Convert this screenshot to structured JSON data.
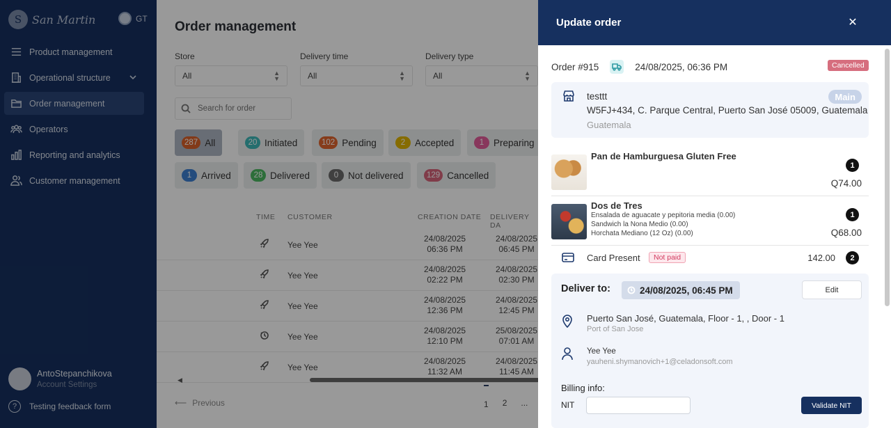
{
  "sidebar": {
    "brand": "San Martin",
    "country": "GT",
    "items": [
      {
        "label": "Product management",
        "icon": "menu-icon"
      },
      {
        "label": "Operational structure",
        "icon": "building-icon"
      },
      {
        "label": "Order management",
        "icon": "folder-icon"
      },
      {
        "label": "Operators",
        "icon": "users-icon"
      },
      {
        "label": "Reporting and analytics",
        "icon": "bar-chart-icon"
      },
      {
        "label": "Customer management",
        "icon": "user-group-icon"
      }
    ],
    "user": {
      "name": "AntoStepanchikova",
      "sub": "Account Settings"
    },
    "feedback": "Testing feedback form"
  },
  "main": {
    "title": "Order management",
    "filters": [
      {
        "label": "Store",
        "value": "All"
      },
      {
        "label": "Delivery time",
        "value": "All"
      },
      {
        "label": "Delivery type",
        "value": "All"
      }
    ],
    "search_placeholder": "Search for order",
    "chips": [
      {
        "count": "287",
        "label": "All",
        "color": "#d9622b"
      },
      {
        "count": "20",
        "label": "Initiated",
        "color": "#3fb8b8"
      },
      {
        "count": "102",
        "label": "Pending",
        "color": "#e0652e"
      },
      {
        "count": "2",
        "label": "Accepted",
        "color": "#e0b400"
      },
      {
        "count": "1",
        "label": "Preparing",
        "color": "#e35c9a"
      },
      {
        "count": "1",
        "label": "Arrived",
        "color": "#3d7fd0"
      },
      {
        "count": "28",
        "label": "Delivered",
        "color": "#4cb862"
      },
      {
        "count": "0",
        "label": "Not delivered",
        "color": "#6b6b6b"
      },
      {
        "count": "129",
        "label": "Cancelled",
        "color": "#d6647a"
      }
    ],
    "columns": {
      "time": "TIME",
      "customer": "CUSTOMER",
      "creation": "CREATION DATE",
      "delivery": "DELIVERY DA"
    },
    "rows": [
      {
        "icon": "rocket-icon",
        "customer": "Yee Yee",
        "c_date": "24/08/2025",
        "c_time": "06:36 PM",
        "d_date": "24/08/2025",
        "d_time": "06:45 PM"
      },
      {
        "icon": "rocket-icon",
        "customer": "Yee Yee",
        "c_date": "24/08/2025",
        "c_time": "02:22 PM",
        "d_date": "24/08/2025",
        "d_time": "02:30 PM"
      },
      {
        "icon": "rocket-icon",
        "customer": "Yee Yee",
        "c_date": "24/08/2025",
        "c_time": "12:36 PM",
        "d_date": "24/08/2025",
        "d_time": "12:45 PM"
      },
      {
        "icon": "clock-icon",
        "customer": "Yee Yee",
        "c_date": "24/08/2025",
        "c_time": "12:10 PM",
        "d_date": "25/08/2025",
        "d_time": "07:01 AM"
      },
      {
        "icon": "rocket-icon",
        "customer": "Yee Yee",
        "c_date": "24/08/2025",
        "c_time": "11:32 AM",
        "d_date": "24/08/2025",
        "d_time": "11:45 AM"
      }
    ],
    "pager": {
      "previous": "Previous",
      "page1": "1",
      "page2": "2",
      "ellipsis": "..."
    }
  },
  "drawer": {
    "title": "Update order",
    "order_number": "Order #915",
    "order_datetime": "24/08/2025, 06:36 PM",
    "status": "Cancelled",
    "store": {
      "name": "testtt",
      "address": "W5FJ+434, C. Parque Central, Puerto San José 05009, Guatemala",
      "city": "Guatemala",
      "badge": "Main"
    },
    "products": [
      {
        "name": "Pan de Hamburguesa Gluten Free",
        "details": [],
        "qty": "1",
        "price": "Q74.00"
      },
      {
        "name": "Dos de Tres",
        "details": [
          "Ensalada de aguacate y pepitoria media (0.00)",
          "Sandwich la Nona Medio (0.00)",
          "Horchata Mediano (12 Oz) (0.00)"
        ],
        "qty": "1",
        "price": "Q68.00"
      }
    ],
    "payment": {
      "method": "Card Present",
      "status": "Not paid",
      "total": "142.00",
      "count": "2"
    },
    "delivery": {
      "label": "Deliver to:",
      "datetime": "24/08/2025, 06:45 PM",
      "edit_label": "Edit",
      "address": "Puerto San José, Guatemala, Floor - 1, , Door - 1",
      "address_sub": "Port of San Jose",
      "customer_name": "Yee Yee",
      "customer_email": "yauheni.shymanovich+1@celadonsoft.com"
    },
    "billing": {
      "label": "Billing info:",
      "nit_label": "NIT",
      "nit_value": "",
      "validate_label": "Validate NIT"
    }
  }
}
